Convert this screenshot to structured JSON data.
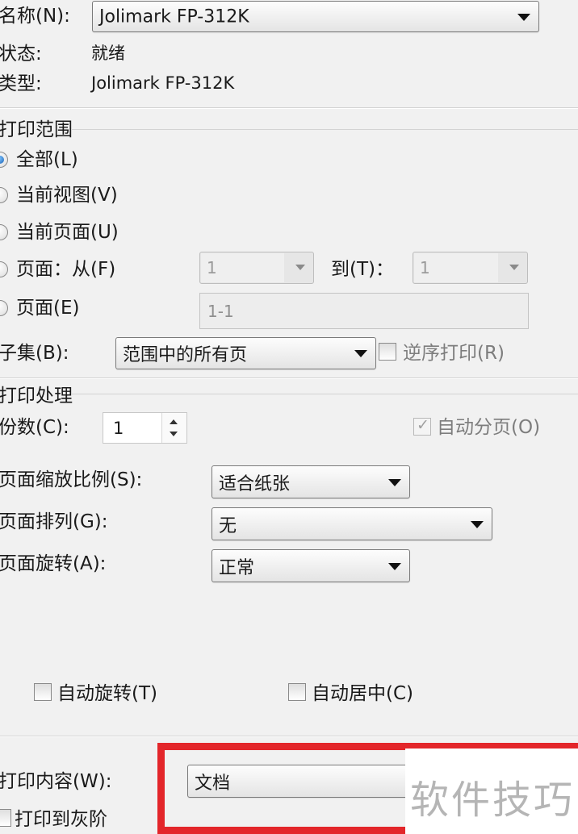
{
  "printer": {
    "name_label": "名称(N):",
    "name_value": "Jolimark FP-312K",
    "status_label": "状态:",
    "status_value": "就绪",
    "type_label": "类型:",
    "type_value": "Jolimark FP-312K"
  },
  "print_range": {
    "group_title": "打印范围",
    "all_label": "全部(L)",
    "current_view_label": "当前视图(V)",
    "current_page_label": "当前页面(U)",
    "pages_from_label": "页面：从(F)",
    "from_value": "1",
    "to_label": "到(T)：",
    "to_value": "1",
    "pages_label": "页面(E)",
    "pages_value": "1-1",
    "subset_label": "子集(B):",
    "subset_value": "范围中的所有页",
    "reverse_label": "逆序打印(R)"
  },
  "print_handling": {
    "group_title": "打印处理",
    "copies_label": "份数(C):",
    "copies_value": "1",
    "collate_label": "自动分页(O)",
    "scaling_label": "页面缩放比例(S):",
    "scaling_value": "适合纸张",
    "arrangement_label": "页面排列(G):",
    "arrangement_value": "无",
    "rotation_label": "页面旋转(A):",
    "rotation_value": "正常",
    "auto_rotate_label": "自动旋转(T)",
    "auto_center_label": "自动居中(C)"
  },
  "print_content": {
    "label": "打印内容(W):",
    "value": "文档",
    "grayscale_label": "打印到灰阶"
  },
  "watermark": "软件技巧"
}
